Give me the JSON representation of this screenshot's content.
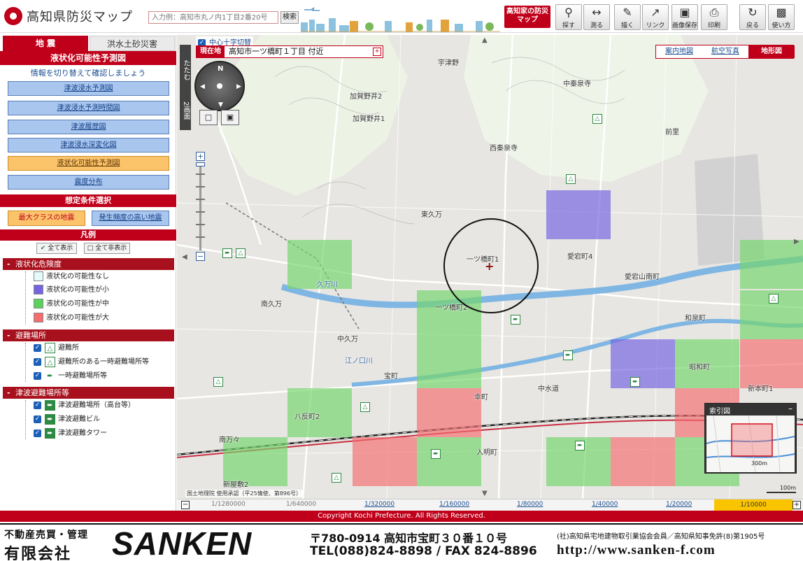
{
  "header": {
    "title": "高知県防災マップ",
    "search_placeholder": "入力例：高知市丸ノ内1丁目2番20号",
    "search_button": "検索",
    "brand_button": "高知家の防災マップ",
    "tools": [
      {
        "label": "探す",
        "icon": "magnifier-icon"
      },
      {
        "label": "測る",
        "icon": "ruler-icon"
      },
      {
        "label": "描く",
        "icon": "pen-icon"
      },
      {
        "label": "リンク",
        "icon": "link-icon"
      },
      {
        "label": "画像保存",
        "icon": "image-save-icon"
      },
      {
        "label": "印刷",
        "icon": "printer-icon"
      },
      {
        "label": "戻る",
        "icon": "back-icon"
      },
      {
        "label": "使い方",
        "icon": "help-icon"
      }
    ]
  },
  "left": {
    "tabs": [
      "地 震",
      "洪水土砂災害"
    ],
    "panel_title": "液状化可能性予測図",
    "panel_sub": "情報を切り替えて確認しましょう",
    "nav": [
      "津波浸水予測図",
      "津波浸水予測時間図",
      "津波履歴図",
      "津波浸水深変化図",
      "液状化可能性予測図",
      "震度分布"
    ],
    "active_nav": "液状化可能性予測図",
    "condition_title": "想定条件選択",
    "condition_max": "最大クラスの地震",
    "condition_freq": "発生頻度の高い地震",
    "legend_title": "凡例",
    "show_all": "全て表示",
    "hide_all": "全て非表示",
    "groups": [
      {
        "title": "液状化危険度",
        "items": [
          {
            "label": "液状化の可能性なし",
            "color": "#e4fbfb"
          },
          {
            "label": "液状化の可能性が小",
            "color": "#7464e2"
          },
          {
            "label": "液状化の可能性が中",
            "color": "#5cd25c"
          },
          {
            "label": "液状化の可能性が大",
            "color": "#f46c70"
          }
        ]
      },
      {
        "title": "避難場所",
        "items": [
          {
            "label": "避難所",
            "icon": "shelter-icon"
          },
          {
            "label": "避難所のある一時避難場所等",
            "icon": "shelter-temp-icon"
          },
          {
            "label": "一時避難場所等",
            "icon": "temp-evac-icon"
          }
        ]
      },
      {
        "title": "津波避難場所等",
        "items": [
          {
            "label": "津波避難場所（高台等）",
            "icon": "tsunami-high-icon"
          },
          {
            "label": "津波避難ビル",
            "icon": "tsunami-building-icon"
          },
          {
            "label": "津波避難タワー",
            "icon": "tsunami-tower-icon"
          }
        ]
      }
    ]
  },
  "map": {
    "cross_toggle": "中心十字切替",
    "location_label": "現在地",
    "location_value": "高知市一ツ橋町１丁目 付近",
    "map_types": [
      "案内地図",
      "航空写真",
      "地形図"
    ],
    "active_map_type": "地形図",
    "collapse_label": "たたむ",
    "split_label": "2画面",
    "compass_n": "N",
    "mini_title": "索引図",
    "mini_scale": "300m",
    "copyright": "国土地理院 使用承認（平25情使、第896号）",
    "scale_text": "100m",
    "labels": [
      "宇津野",
      "加賀野井2",
      "加賀野井1",
      "中秦泉寺",
      "西秦泉寺",
      "前里",
      "東久万",
      "一ツ橋町1",
      "愛宕町4",
      "愛宕山南町",
      "南久万",
      "一ツ橋町2",
      "和泉町",
      "中久万",
      "宝町",
      "中水道",
      "昭和町",
      "新本町1",
      "八反町2",
      "幸町",
      "入明町",
      "南万々",
      "新屋敷2",
      "久万川",
      "江ノ口川"
    ]
  },
  "scales": [
    "1/1280000",
    "1/640000",
    "1/320000",
    "1/160000",
    "1/80000",
    "1/40000",
    "1/20000",
    "1/10000"
  ],
  "active_scale": "1/10000",
  "copyright": "Copyright Kochi Prefecture. All Rights Reserved.",
  "ad": {
    "line1": "不動産売買・管理",
    "line2": "有限会社",
    "brand": "SANKEN",
    "addr": "〒780-0914 高知市宝町３０番１０号",
    "tel": "TEL(088)824-8898 / FAX 824-8896",
    "license": "(社)高知県宅地建物取引業協会会員／高知県知事免許(8)第1905号",
    "url": "http://www.sanken-f.com"
  }
}
